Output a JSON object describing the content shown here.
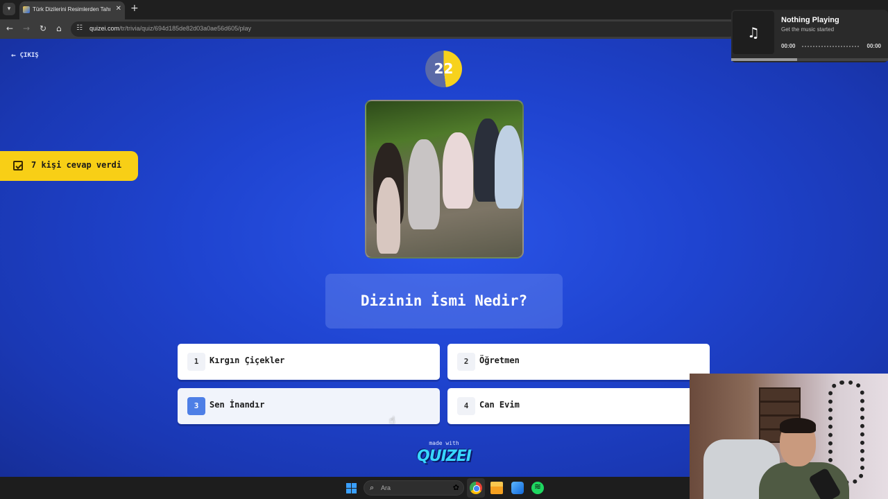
{
  "browser": {
    "tab_title": "Türk Dizilerini Resimlerden Tahmin",
    "url_host": "quizei.com",
    "url_path": "/tr/trivia/quiz/694d185de82d03a0ae56d605/play",
    "icons": [
      "chevron-down-icon",
      "close-icon",
      "plus-icon",
      "back-icon",
      "forward-icon",
      "reload-icon",
      "home-icon",
      "site-info-icon"
    ]
  },
  "quiz": {
    "exit_label": "ÇIKIŞ",
    "timer": 22,
    "timer_fill_fraction": 0.48,
    "answered_badge": "7 kişi cevap verdi",
    "question": "Dizinin İsmi Nedir?",
    "options": [
      {
        "num": "1",
        "label": "Kırgın Çiçekler"
      },
      {
        "num": "2",
        "label": "Öğretmen"
      },
      {
        "num": "3",
        "label": "Sen İnandır"
      },
      {
        "num": "4",
        "label": "Can Evim"
      }
    ],
    "made_with": "made with",
    "logo": "QUIZEI"
  },
  "media": {
    "title": "Nothing Playing",
    "subtitle": "Get the music started",
    "time_current": "00:00",
    "time_total": "00:00",
    "icon": "music-note-icon"
  },
  "taskbar": {
    "search_placeholder": "Ara",
    "apps": [
      "windows-start-icon",
      "chrome-icon",
      "file-explorer-icon",
      "photos-icon",
      "spotify-icon"
    ]
  },
  "colors": {
    "accent_yellow": "#f8cf16",
    "background_blue": "#1f44d0",
    "hover_number": "#4e7fe6"
  }
}
